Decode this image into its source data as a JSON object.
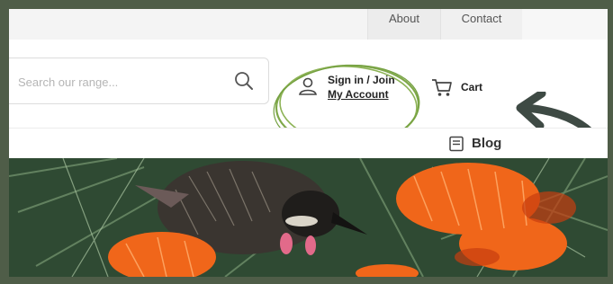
{
  "topbar": {
    "links": [
      "About",
      "Contact"
    ]
  },
  "search": {
    "placeholder": "Search our range..."
  },
  "account": {
    "line1": "Sign in / Join",
    "line2": "My Account",
    "icon": "user-icon"
  },
  "cart": {
    "label": "Cart",
    "icon": "cart-icon"
  },
  "nav": {
    "blog_label": "Blog",
    "blog_icon": "blog-icon"
  },
  "colors": {
    "frame": "#4f5d48",
    "highlight_circle": "#7fa84a",
    "arrow": "#3e4a44",
    "flower": "#f0661a"
  },
  "hero": {
    "description_icon": "bird-on-banksia-photo"
  }
}
